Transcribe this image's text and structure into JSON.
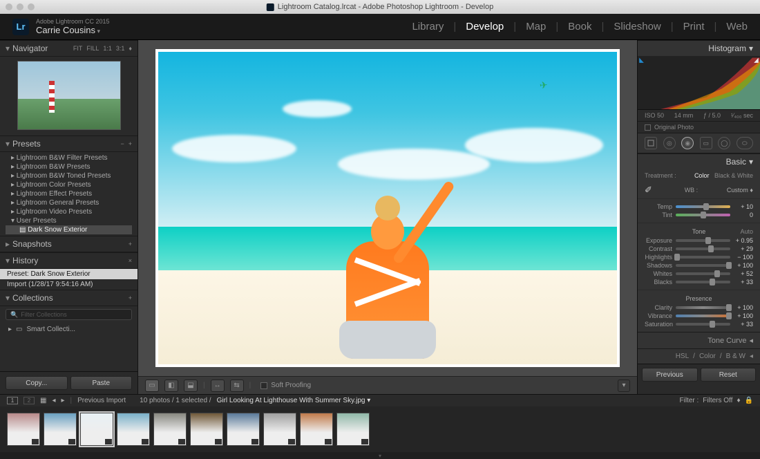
{
  "titlebar": {
    "text": "Lightroom Catalog.lrcat - Adobe Photoshop Lightroom - Develop"
  },
  "header": {
    "logo": "Lr",
    "appLine": "Adobe Lightroom CC 2015",
    "userLine": "Carrie Cousins",
    "modules": [
      "Library",
      "Develop",
      "Map",
      "Book",
      "Slideshow",
      "Print",
      "Web"
    ],
    "activeModule": "Develop"
  },
  "leftPanels": {
    "navigator": {
      "title": "Navigator",
      "fit": "FIT",
      "fill": "FILL",
      "r1": "1:1",
      "r2": "3:1"
    },
    "presets": {
      "title": "Presets",
      "groups": [
        "Lightroom B&W Filter Presets",
        "Lightroom B&W Presets",
        "Lightroom B&W Toned Presets",
        "Lightroom Color Presets",
        "Lightroom Effect Presets",
        "Lightroom General Presets",
        "Lightroom Video Presets",
        "User Presets"
      ],
      "selected": "Dark Snow Exterior"
    },
    "snapshots": {
      "title": "Snapshots"
    },
    "history": {
      "title": "History",
      "items": [
        "Preset: Dark Snow Exterior",
        "Import (1/28/17 9:54:16 AM)"
      ]
    },
    "collections": {
      "title": "Collections",
      "searchPlaceholder": "Filter Collections",
      "smart": "Smart Collecti..."
    },
    "copy": "Copy...",
    "paste": "Paste"
  },
  "centerToolbar": {
    "softProofing": "Soft Proofing"
  },
  "rightPanels": {
    "histogram": {
      "title": "Histogram",
      "exif": {
        "iso": "ISO 50",
        "focal": "14 mm",
        "aperture": "ƒ / 5.0",
        "shutter": "¹⁄₄₀₀ sec"
      },
      "original": "Original Photo"
    },
    "basic": {
      "title": "Basic",
      "treatmentLabel": "Treatment :",
      "treatColor": "Color",
      "treatBW": "Black & White",
      "wbLabel": "WB :",
      "wbMode": "Custom",
      "temp": {
        "label": "Temp",
        "value": "+ 10",
        "pos": 56
      },
      "tint": {
        "label": "Tint",
        "value": "0",
        "pos": 50
      },
      "toneTitle": "Tone",
      "autoLabel": "Auto",
      "exposure": {
        "label": "Exposure",
        "value": "+ 0.95",
        "pos": 60
      },
      "contrast": {
        "label": "Contrast",
        "value": "+ 29",
        "pos": 65
      },
      "highlights": {
        "label": "Highlights",
        "value": "− 100",
        "pos": 2
      },
      "shadows": {
        "label": "Shadows",
        "value": "+ 100",
        "pos": 98
      },
      "whites": {
        "label": "Whites",
        "value": "+ 52",
        "pos": 76
      },
      "blacks": {
        "label": "Blacks",
        "value": "+ 33",
        "pos": 67
      },
      "presenceTitle": "Presence",
      "clarity": {
        "label": "Clarity",
        "value": "+ 100",
        "pos": 98
      },
      "vibrance": {
        "label": "Vibrance",
        "value": "+ 100",
        "pos": 98
      },
      "saturation": {
        "label": "Saturation",
        "value": "+ 33",
        "pos": 67
      }
    },
    "toneCurve": "Tone Curve",
    "hsl": {
      "h": "HSL",
      "c": "Color",
      "bw": "B & W"
    },
    "previous": "Previous",
    "reset": "Reset"
  },
  "filmstripBar": {
    "mon1": "1",
    "mon2": "2",
    "prevImport": "Previous Import",
    "count": "10 photos / 1 selected /",
    "filename": "Girl Looking At Lighthouse With Summer Sky.jpg",
    "filterLabel": "Filter :",
    "filterMode": "Filters Off"
  },
  "thumbs": {
    "colors": [
      "#b88a8a",
      "#6aa0c0",
      "#e8f0f4",
      "#7ab0c8",
      "#888880",
      "#705838",
      "#5a7a9a",
      "#a0a0a0",
      "#c07a4a",
      "#90b8a8"
    ],
    "selectedIndex": 2
  }
}
